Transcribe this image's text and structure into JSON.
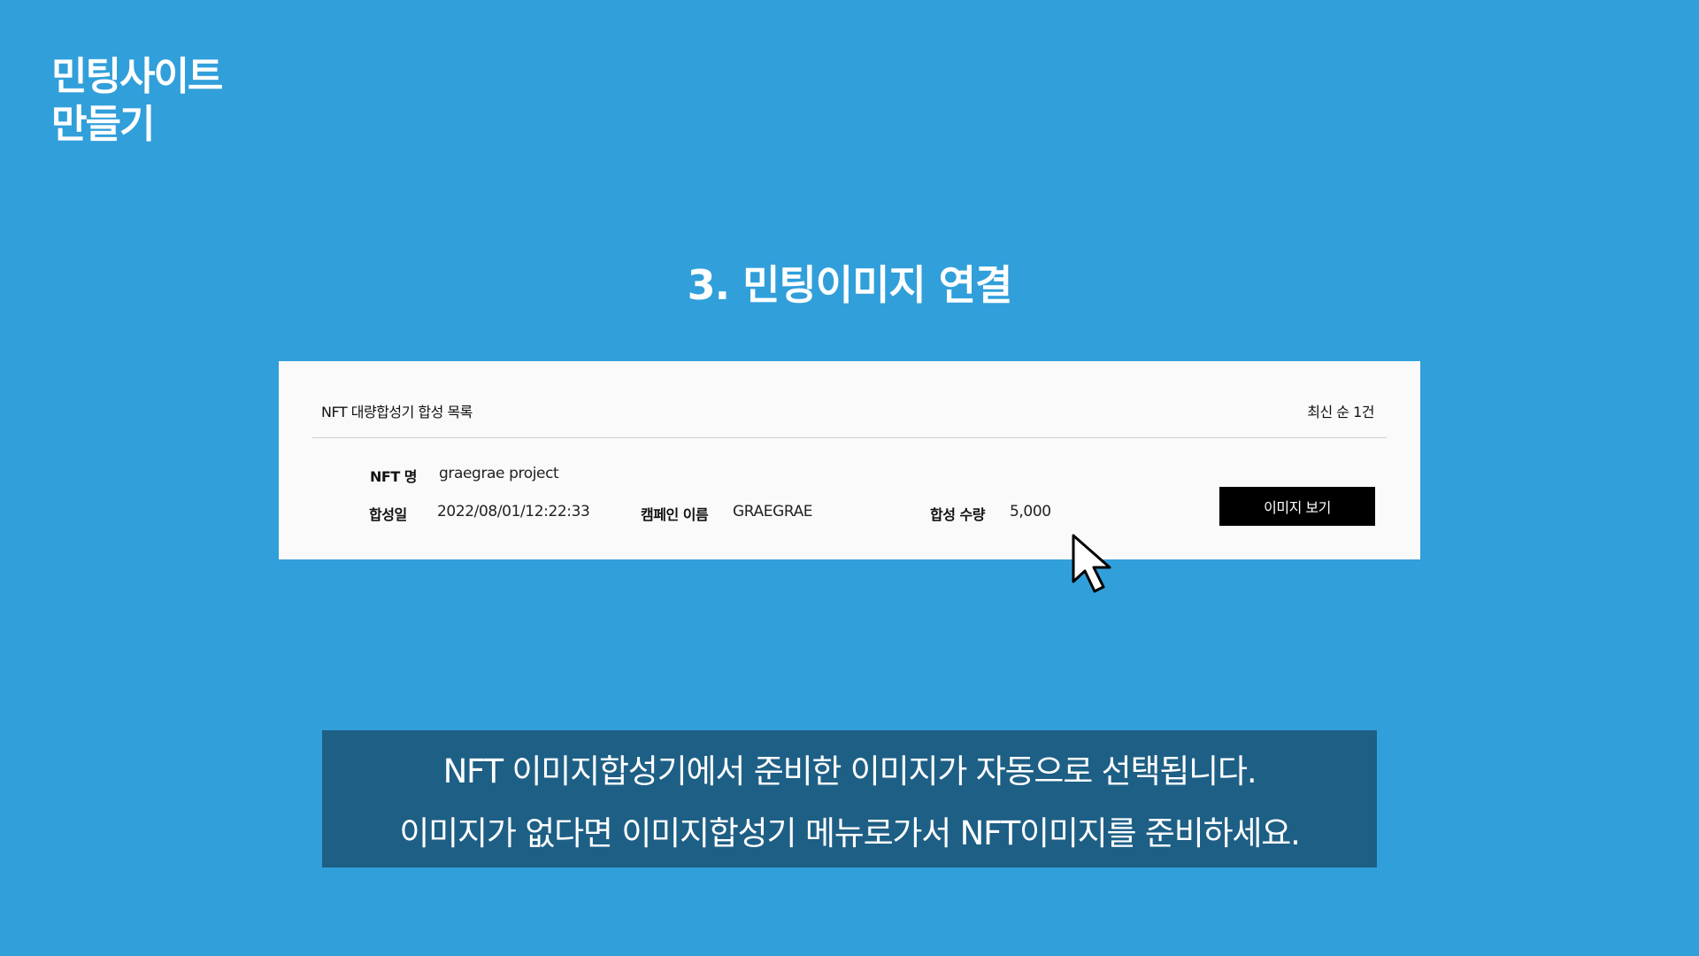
{
  "logo": {
    "line1": "민팅사이트",
    "line2": "만들기"
  },
  "section_title": "3. 민팅이미지 연결",
  "card": {
    "title": "NFT 대량합성기 합성 목록",
    "sort_info": "최신 순 1건",
    "fields": {
      "nft_name_label": "NFT 명",
      "nft_name_value": "graegrae project",
      "date_label": "합성일",
      "date_value": "2022/08/01/12:22:33",
      "campaign_label": "캠페인 이름",
      "campaign_value": "GRAEGRAE",
      "quantity_label": "합성 수량",
      "quantity_value": "5,000"
    },
    "view_button_label": "이미지 보기"
  },
  "caption": {
    "line1": "NFT 이미지합성기에서 준비한 이미지가 자동으로 선택됩니다.",
    "line2": "이미지가 없다면 이미지합성기 메뉴로가서 NFT이미지를 준비하세요."
  },
  "colors": {
    "background": "#319fda",
    "card": "#fafafa",
    "caption_bg": "#1e5f85",
    "button": "#000000"
  },
  "icons": {
    "pointer": "mouse-cursor-icon"
  }
}
